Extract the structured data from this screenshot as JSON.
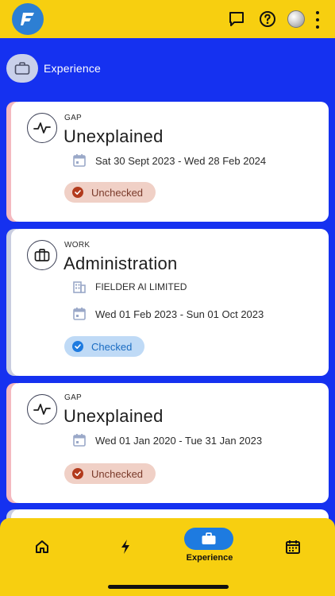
{
  "header": {
    "logo_icon": "fielder-logo-icon",
    "actions": [
      "chat-icon",
      "help-icon",
      "avatar-icon",
      "more-vertical-icon"
    ]
  },
  "section": {
    "icon": "briefcase-icon",
    "title": "Experience"
  },
  "cards": [
    {
      "kind": "gap",
      "type_label": "GAP",
      "title": "Unexplained",
      "org": "",
      "dates": "Sat 30 Sept 2023 - Wed 28 Feb 2024",
      "status": "Unchecked",
      "stripe_color": "#f4b9c0"
    },
    {
      "kind": "work",
      "type_label": "WORK",
      "title": "Administration",
      "org": "FIELDER AI LIMITED",
      "dates": "Wed 01 Feb 2023 - Sun 01 Oct 2023",
      "status": "Checked",
      "stripe_color": "#c9cde0"
    },
    {
      "kind": "gap",
      "type_label": "GAP",
      "title": "Unexplained",
      "org": "",
      "dates": "Wed 01 Jan 2020 - Tue 31 Jan 2023",
      "status": "Unchecked",
      "stripe_color": "#f4b9c0"
    }
  ],
  "bottom_nav": {
    "items": [
      "home-icon",
      "lightning-icon",
      "briefcase-icon",
      "calendar-icon"
    ],
    "active_label": "Experience"
  },
  "colors": {
    "brand_yellow": "#f7cf10",
    "background_blue": "#1531f0",
    "accent_blue": "#1e7be0",
    "unchecked_red": "#b23a1c"
  }
}
